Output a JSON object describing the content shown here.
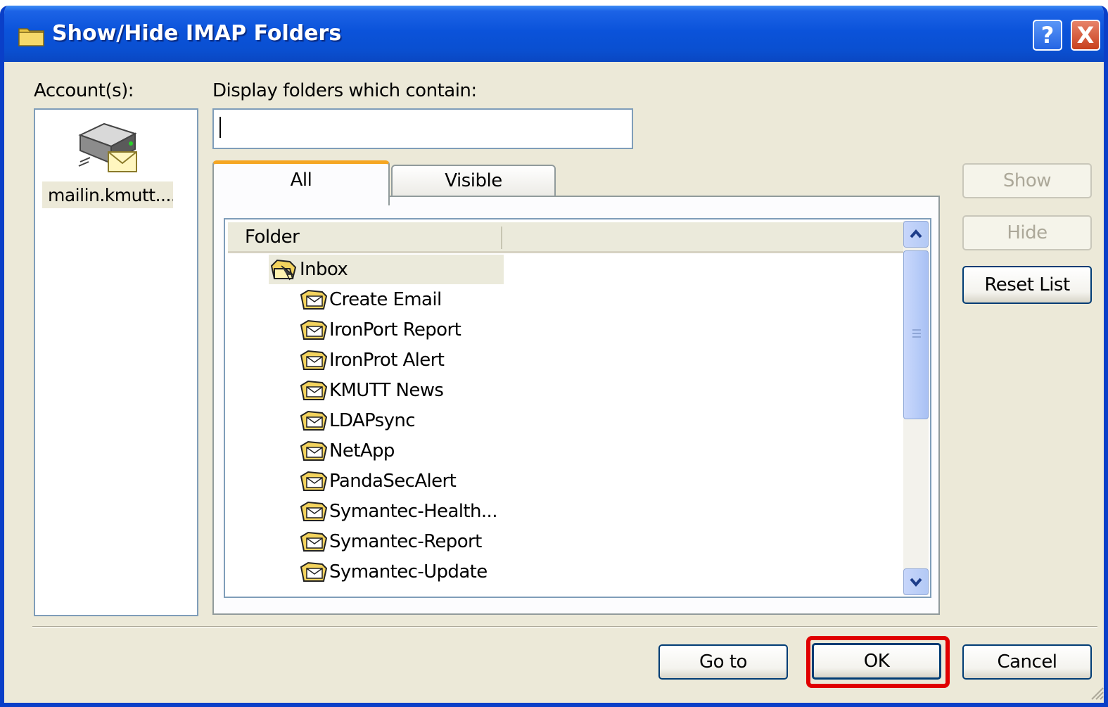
{
  "window": {
    "title": "Show/Hide IMAP Folders",
    "help_button": "?",
    "close_button": "X"
  },
  "accounts": {
    "label": "Account(s):",
    "items": [
      {
        "label": "mailin.kmutt...."
      }
    ]
  },
  "filter": {
    "label": "Display folders which contain:",
    "value": ""
  },
  "tabs": [
    {
      "label": "All",
      "active": true
    },
    {
      "label": "Visible",
      "active": false
    }
  ],
  "folder_list": {
    "column_header": "Folder",
    "rows": [
      {
        "label": "Inbox"
      },
      {
        "label": "Create Email"
      },
      {
        "label": "IronPort Report"
      },
      {
        "label": "IronProt Alert"
      },
      {
        "label": "KMUTT News"
      },
      {
        "label": "LDAPsync"
      },
      {
        "label": "NetApp"
      },
      {
        "label": "PandaSecAlert"
      },
      {
        "label": "Symantec-Health..."
      },
      {
        "label": "Symantec-Report"
      },
      {
        "label": "Symantec-Update"
      }
    ]
  },
  "side_buttons": {
    "show": "Show",
    "hide": "Hide",
    "reset": "Reset List"
  },
  "footer_buttons": {
    "goto": "Go to",
    "ok": "OK",
    "cancel": "Cancel"
  },
  "colors": {
    "titlebar": "#0a4fd0",
    "dialog_bg": "#ece9d8",
    "tab_accent": "#f5a623",
    "highlight": "#e00000"
  }
}
